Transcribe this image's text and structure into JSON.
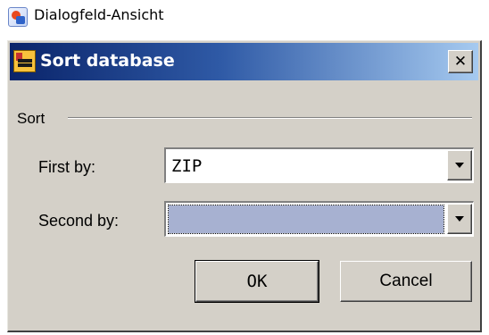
{
  "viewer": {
    "title": "Dialogfeld-Ansicht",
    "icon": "dialog-view-icon"
  },
  "dialog": {
    "title": "Sort database",
    "title_icon": "sort-database-icon",
    "close_label": "✕",
    "group_label": "Sort",
    "fields": {
      "first": {
        "label": "First by:",
        "value": "ZIP"
      },
      "second": {
        "label": "Second by:",
        "value": ""
      }
    },
    "buttons": {
      "ok": "OK",
      "cancel": "Cancel"
    }
  },
  "colors": {
    "dialog_face": "#d4d0c8",
    "titlebar_start": "#0a246a",
    "titlebar_end": "#a6caf0",
    "selection_fill": "#a7b1d1"
  }
}
